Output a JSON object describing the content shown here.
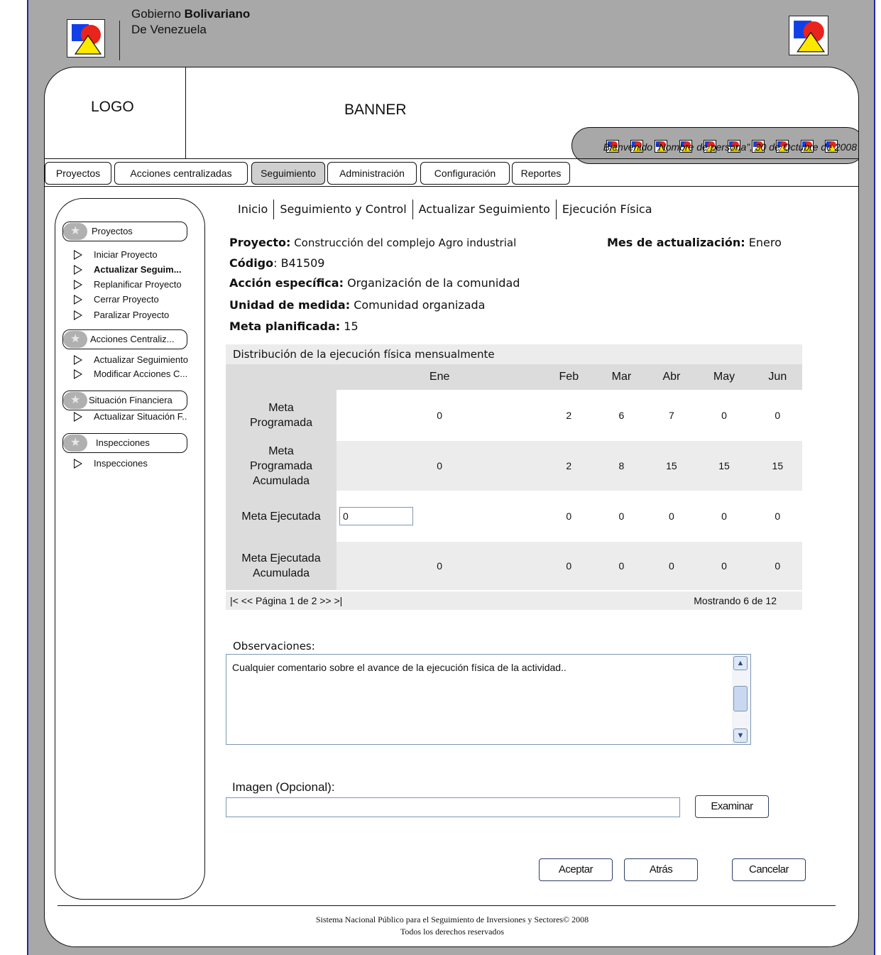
{
  "header": {
    "gov_line1_prefix": "Gobierno ",
    "gov_line1_bold": "Bolivariano",
    "gov_line2": "De Venezuela"
  },
  "logo_label": "LOGO",
  "banner_label": "BANNER",
  "welcome": "Bienvenido “Nombre de persona”, 30 de Octubre de 2008",
  "menu": [
    {
      "label": "Proyectos"
    },
    {
      "label": "Acciones centralizadas"
    },
    {
      "label": "Seguimiento",
      "active": true
    },
    {
      "label": "Administración"
    },
    {
      "label": "Configuración"
    },
    {
      "label": "Reportes"
    }
  ],
  "sidebar": {
    "groups": [
      {
        "label": "Proyectos",
        "items": [
          "Iniciar Proyecto",
          "Actualizar Seguim...",
          "Replanificar Proyecto",
          "Cerrar Proyecto",
          "Paralizar Proyecto"
        ]
      },
      {
        "label": "Acciones Centraliz...",
        "items": [
          "Actualizar Seguimiento",
          "Modificar Acciones C..."
        ]
      },
      {
        "label": "Situación Financiera",
        "items": [
          "Actualizar Situación F.."
        ]
      },
      {
        "label": "Inspecciones",
        "items": [
          "Inspecciones"
        ]
      }
    ]
  },
  "breadcrumb": [
    "Inicio",
    "Seguimiento y Control",
    "Actualizar Seguimiento",
    "Ejecución Física"
  ],
  "project": {
    "proyecto_label": "Proyecto:",
    "proyecto_value": " Construcción del complejo Agro industrial",
    "mes_label": "Mes de actualización:",
    "mes_value": " Enero",
    "codigo_label": "Código",
    "codigo_value": ": B41509",
    "accion_label": "Acción específica:",
    "accion_value": " Organización de la comunidad",
    "unidad_label": "Unidad de medida:",
    "unidad_value": " Comunidad organizada",
    "meta_label": "Meta planificada:",
    "meta_value": " 15"
  },
  "distribution": {
    "title": "Distribución de la ejecución física mensualmente",
    "months": [
      "Ene",
      "Feb",
      "Mar",
      "Abr",
      "May",
      "Jun"
    ],
    "rows": [
      {
        "label": "Meta Programada",
        "values": [
          "0",
          "2",
          "6",
          "7",
          "0",
          "0"
        ]
      },
      {
        "label": "Meta Programada Acumulada",
        "values": [
          "0",
          "2",
          "8",
          "15",
          "15",
          "15"
        ]
      },
      {
        "label": "Meta Ejecutada",
        "input_value": "0",
        "values": [
          "0",
          "0",
          "0",
          "0",
          "0"
        ]
      },
      {
        "label": "Meta Ejecutada Acumulada",
        "values": [
          "0",
          "0",
          "0",
          "0",
          "0",
          "0"
        ]
      }
    ],
    "pager": "|<  << Página 1 de 2 >>  >|",
    "showing": "Mostrando 6 de 12"
  },
  "observaciones": {
    "label": "Observaciones:",
    "value": "Cualquier comentario sobre el avance de la ejecución física de la actividad.."
  },
  "imagen": {
    "label": "Imagen (Opcional):",
    "browse": "Examinar"
  },
  "buttons": {
    "accept": "Aceptar",
    "back": "Atrás",
    "cancel": "Cancelar"
  },
  "footer": {
    "line1": "Sistema Nacional Público para el Seguimiento de Inversiones y Sectores© 2008",
    "line2": "Todos los derechos reservados"
  },
  "colors": {
    "frame": "#a8a8a8",
    "border_blue": "#1f2a9b",
    "logo_blue": "#1240e6",
    "logo_red": "#e8241d",
    "logo_yellow": "#ffe800"
  }
}
